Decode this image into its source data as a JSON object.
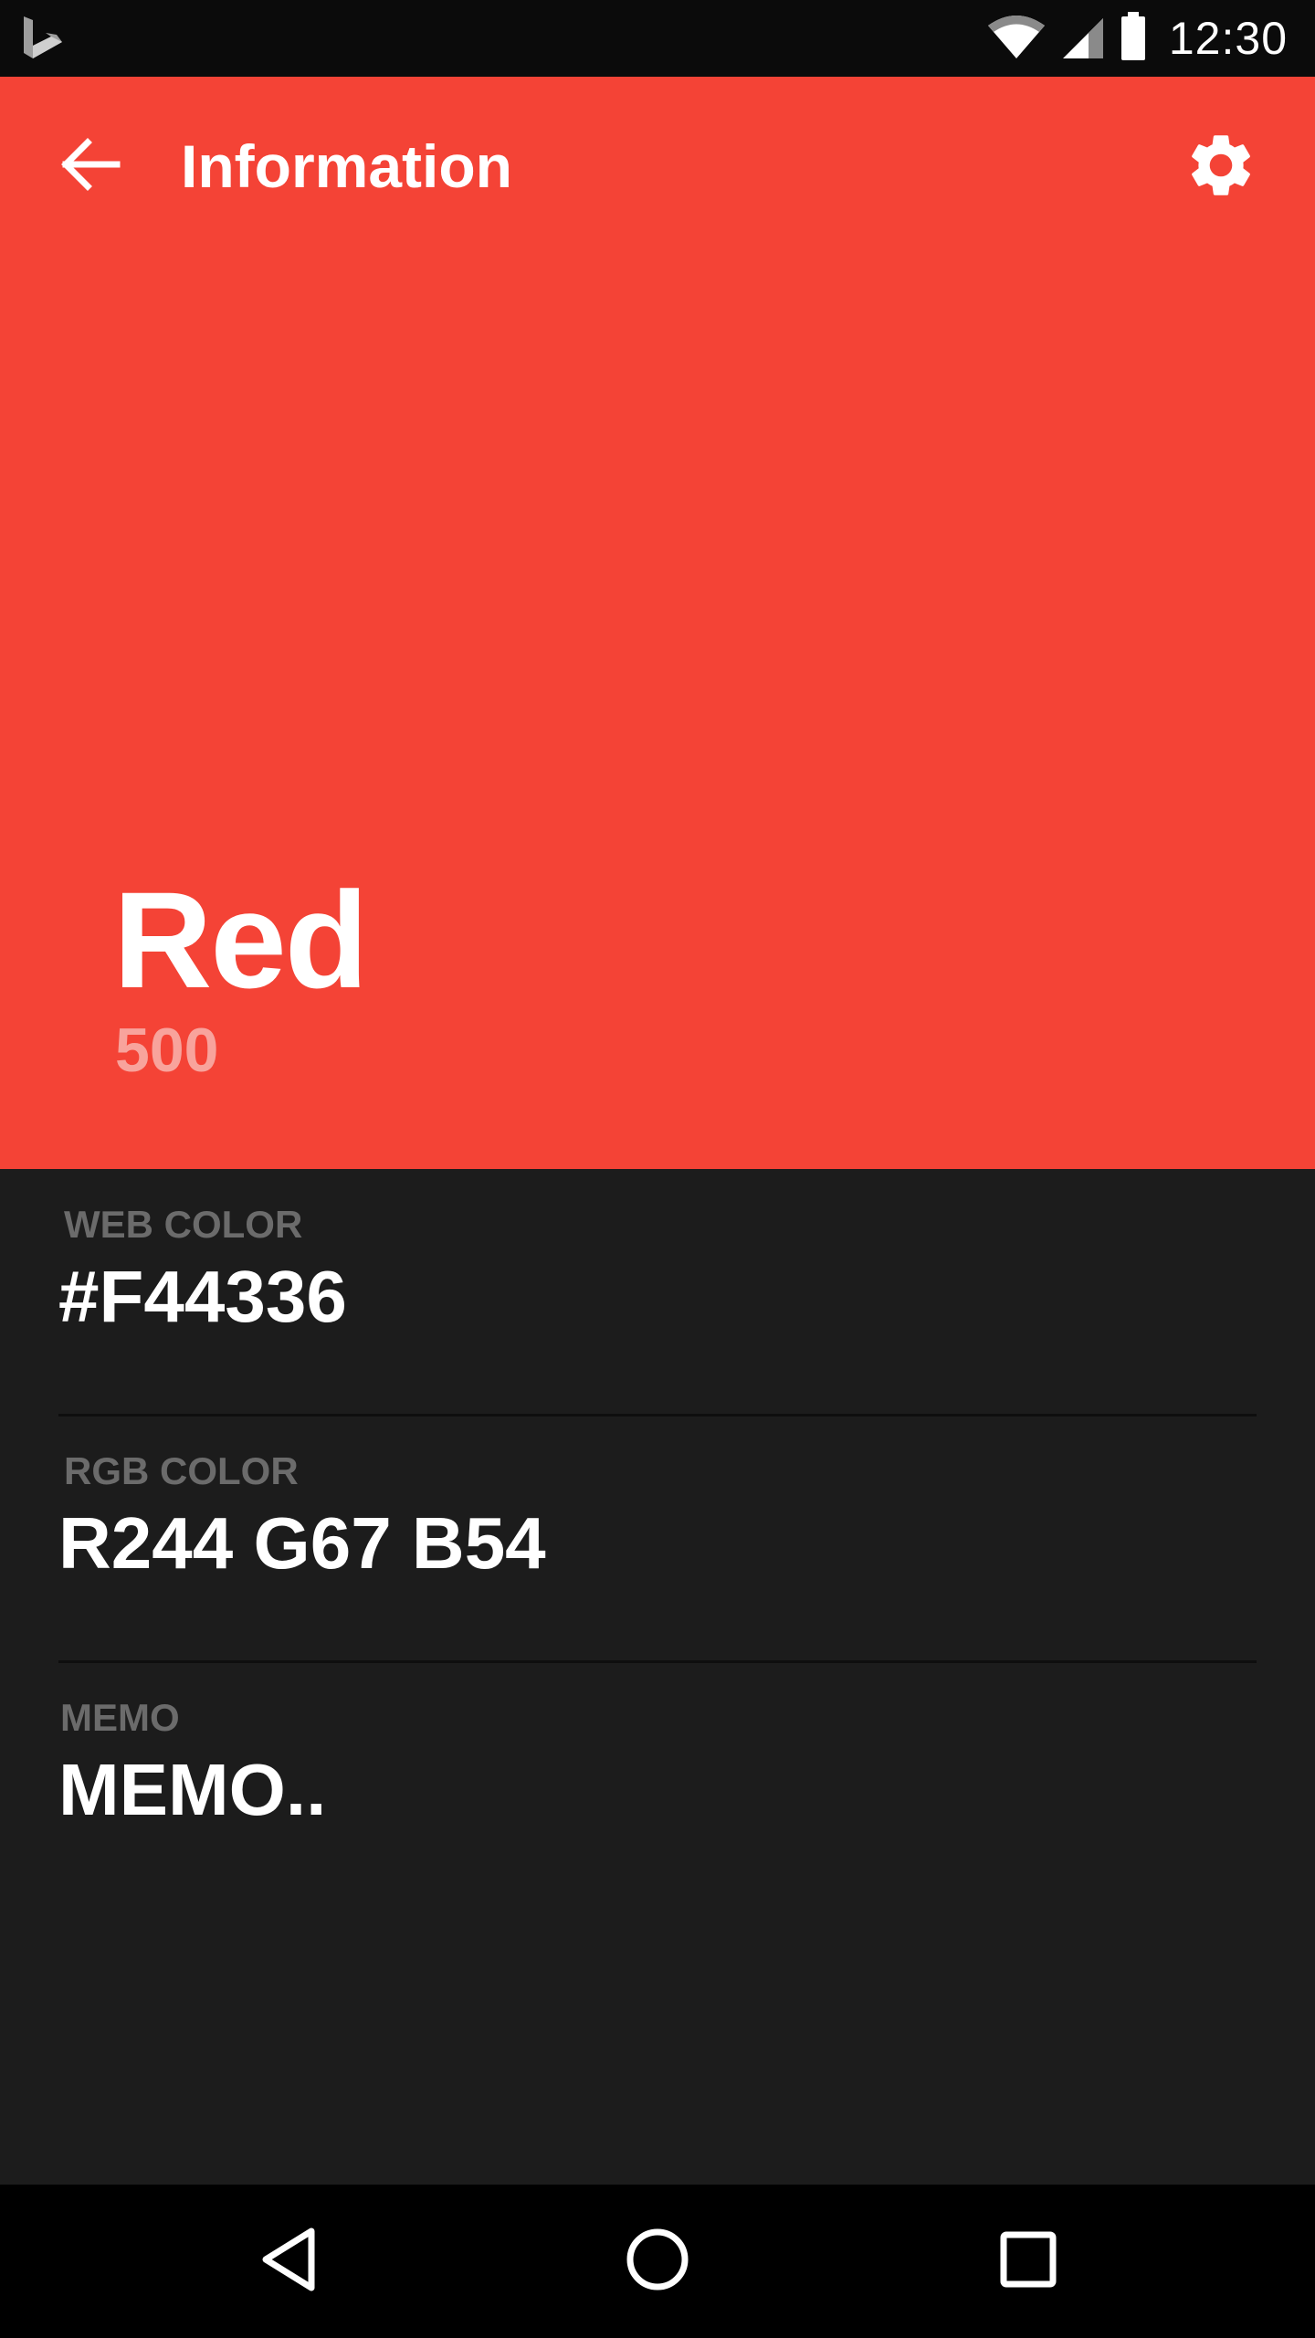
{
  "status_bar": {
    "time": "12:30",
    "icons": [
      "bing-icon",
      "wifi-icon",
      "cell-signal-icon",
      "battery-icon"
    ]
  },
  "toolbar": {
    "title": "Information",
    "back_icon": "arrow-back-icon",
    "settings_icon": "gear-icon"
  },
  "color": {
    "name": "Red",
    "shade": "500",
    "hex": "#F44336"
  },
  "info": {
    "web_color": {
      "label": "WEB COLOR",
      "value": "#F44336"
    },
    "rgb_color": {
      "label": "RGB COLOR",
      "value": "R244 G67 B54"
    },
    "memo": {
      "label": "MEMO",
      "value": "MEMO.."
    }
  },
  "nav_bar": {
    "icons": [
      "back-triangle-icon",
      "home-circle-icon",
      "recents-square-icon"
    ]
  }
}
